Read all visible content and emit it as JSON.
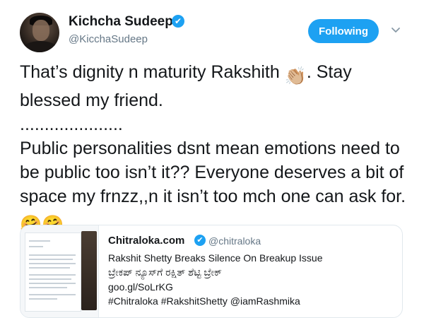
{
  "author": {
    "name": "Kichcha Sudeepa",
    "handle": "@KicchaSudeep",
    "verified_mark": "✔"
  },
  "follow_button": {
    "label": "Following",
    "color": "#1da1f2"
  },
  "menu": {
    "icon": "chevron-down-icon"
  },
  "tweet": {
    "line1_text": "That’s dignity n maturity Rakshith ",
    "line1_emoji": "👏🏼",
    "line1_suffix": ". Stay blessed my friend.",
    "divider": ".....................",
    "paragraph": "Public personalities dsnt mean emotions need to be public too isn’t it?? Everyone deserves a bit of space my frnzz,,n it isn’t too mch one can ask for. ",
    "end_emoji": "🤗🤗"
  },
  "quoted": {
    "name": "Chitraloka.com",
    "handle": "@chitraloka",
    "verified_mark": "✔",
    "lines": [
      "Rakshit Shetty Breaks Silence On Breakup Issue",
      "ಬ್ರೇಕಪ್ ನ್ಯೂಸ್‌ಗೆ ರಕ್ಷಿತ್ ಶೆಟ್ಟಿ ಬ್ರೇಕ್",
      "goo.gl/SoLrKG",
      "#Chitraloka #RakshitShetty @iamRashmika"
    ]
  },
  "colors": {
    "text": "#14171a",
    "secondary": "#657786",
    "accent": "#1da1f2",
    "border": "#e1e8ed"
  }
}
